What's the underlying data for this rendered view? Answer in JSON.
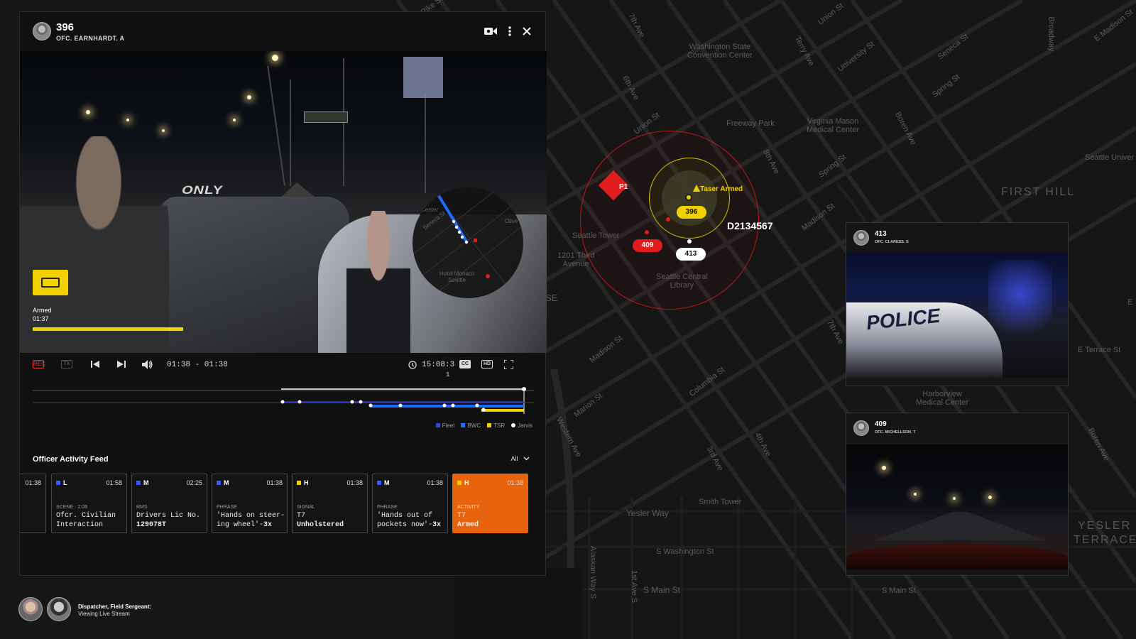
{
  "map": {
    "labels": {
      "first_hill": "FIRST HILL",
      "yesler_terrace_1": "YESLER",
      "yesler_terrace_2": "TERRACE",
      "washington_convention": "Washington State\nConvention Center",
      "freeway_park": "Freeway Park",
      "virginia_mason": "Virginia Mason\nMedical Center",
      "seattle_univ": "Seattle Univer",
      "seattle_tower": "Seattle Tower",
      "third_ave": "1201 Third\nAvenue",
      "central_library": "Seattle Central\nLibrary",
      "harborview": "Harborview\nMedical Center",
      "smith_tower": "Smith Tower",
      "yesler_way": "Yesler Way",
      "s_washington": "S Washington St",
      "s_main": "S Main St",
      "s_main2": "S Main St",
      "e_terrace": "E Terrace St",
      "madison_st": "Madison St",
      "marion_st": "Marion St",
      "columbia_st": "Columbia St",
      "spring_st": "Spring St",
      "seneca_st": "Seneca St",
      "union_st": "Union St",
      "university_st": "University St",
      "pike_st": "Pike St",
      "seventh_ave": "7th Ave",
      "sixth_ave": "6th Ave",
      "eighth_ave": "8th Ave",
      "boren_ave": "Boren Ave",
      "broadway": "Broadway",
      "e_madison": "E Madison St",
      "alaskan_way": "Alaskan Way S",
      "first_ave_s": "1st Ave S",
      "third_ave_lbl": "3rd Ave",
      "fourth_ave": "4th Ave",
      "western_ave": "Western Ave",
      "terry_ave": "Terry Ave",
      "e_label": "E",
      "se_label": "SE"
    },
    "incident": {
      "priority": "P1",
      "alert": "Taser Armed",
      "id": "D2134567",
      "unit_396": "396",
      "unit_409": "409",
      "unit_413": "413"
    }
  },
  "panel": {
    "unit": "396",
    "officer": "OFC. EARNHARDT. A",
    "icons": [
      "camera-icon",
      "more-vert-icon",
      "close-icon"
    ],
    "video": {
      "road_marking": "ONLY",
      "armed_label": "Armed",
      "armed_time": "01:37",
      "armed_progress": 0.3,
      "minimap_labels": [
        "Seneca St",
        "Hotel Monaco\nSeattle",
        "Olive",
        "Center"
      ]
    },
    "controls": {
      "rec_label": "REC",
      "tx_label": "TX",
      "time_range": "01:38 - 01:38",
      "clock_time": "15:08:3",
      "clock_sub": "1",
      "cc_label": "CC",
      "hd_label": "HD"
    },
    "legend": [
      {
        "name": "Fleet",
        "color": "#2e4bd6"
      },
      {
        "name": "BWC",
        "color": "#1e6bff"
      },
      {
        "name": "TSR",
        "color": "#f2d100"
      },
      {
        "name": "Jarvis",
        "color": "#ffffff"
      }
    ],
    "feed": {
      "title": "Officer Activity Feed",
      "filter": "All",
      "cards": [
        {
          "level": "",
          "time": "01:38",
          "category": "",
          "line1": "",
          "line2": "",
          "color": ""
        },
        {
          "level": "L",
          "time": "01:58",
          "category": "SCENE · 2:08",
          "line1": "Ofcr. Civilian",
          "line2": "Interaction",
          "color": "#2e5cff"
        },
        {
          "level": "M",
          "time": "02:25",
          "category": "RMS",
          "line1": "Drivers Lic No.",
          "line2": "129078T",
          "color": "#2e5cff"
        },
        {
          "level": "M",
          "time": "01:38",
          "category": "PHRASE",
          "line1": "'Hands on steer-",
          "line2": "ing wheel'-",
          "suffix": "3x",
          "color": "#2e5cff"
        },
        {
          "level": "H",
          "time": "01:38",
          "category": "SIGNAL",
          "line1": "T7",
          "line2": "Unholstered",
          "color": "#f2d100"
        },
        {
          "level": "M",
          "time": "01:38",
          "category": "PHRASE",
          "line1": "'Hands out of",
          "line2": "pockets now'-",
          "suffix": "3x",
          "color": "#2e5cff"
        },
        {
          "level": "H",
          "time": "01:38",
          "category": "ACTIVITY",
          "line1": "T7",
          "line2": "Armed",
          "color": "#f2d100"
        }
      ]
    }
  },
  "cams": [
    {
      "unit": "413",
      "officer": "OFC. CLARESS. S",
      "overlay_text": "POLICE",
      "map_label": "Harborview\nMedical Center"
    },
    {
      "unit": "409",
      "officer": "OFC. MICHELLSON. T"
    }
  ],
  "viewers": {
    "line1": "Dispatcher, Field Sergeant:",
    "line2": "Viewing Live Stream"
  }
}
